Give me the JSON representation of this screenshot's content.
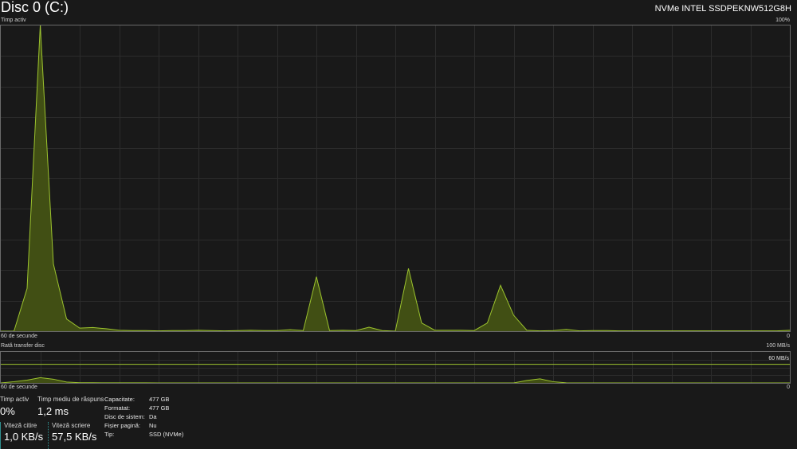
{
  "header": {
    "title": "Disc 0 (C:)",
    "model": "NVMe INTEL SSDPEKNW512G8H"
  },
  "active_chart": {
    "label": "Timp activ",
    "max_label": "100%",
    "time_label": "60 de secunde",
    "min_label": "0"
  },
  "transfer_chart": {
    "label": "Rată transfer disc",
    "max_label": "100 MB/s",
    "line_label": "60 MB/s",
    "time_label": "60 de secunde",
    "min_label": "0"
  },
  "stats": {
    "active_time": {
      "label": "Timp activ",
      "value": "0%"
    },
    "avg_response": {
      "label": "Timp mediu de răspuns",
      "value": "1,2 ms"
    },
    "read_speed": {
      "label": "Viteză citire",
      "value": "1,0 KB/s"
    },
    "write_speed": {
      "label": "Viteză scriere",
      "value": "57,5 KB/s"
    }
  },
  "properties": [
    {
      "label": "Capacitate:",
      "value": "477 GB"
    },
    {
      "label": "Formatat:",
      "value": "477 GB"
    },
    {
      "label": "Disc de sistem:",
      "value": "Da"
    },
    {
      "label": "Fișier pagină:",
      "value": "Nu"
    },
    {
      "label": "Tip:",
      "value": "SSD (NVMe)"
    }
  ],
  "colors": {
    "background": "#191919",
    "grid": "#2c2c2c",
    "border": "#6a6a6a",
    "fill": "#414f14",
    "line": "#9cc32e",
    "accent_teal": "#2f8f8f"
  },
  "chart_data": [
    {
      "type": "area",
      "title": "Timp activ",
      "xlabel": "60 de secunde",
      "ylabel": "",
      "ylim": [
        0,
        100
      ],
      "x": [
        0,
        1,
        2,
        3,
        4,
        5,
        6,
        7,
        8,
        9,
        10,
        11,
        12,
        13,
        14,
        15,
        16,
        17,
        18,
        19,
        20,
        21,
        22,
        23,
        24,
        25,
        26,
        27,
        28,
        29,
        30,
        31,
        32,
        33,
        34,
        35,
        36,
        37,
        38,
        39,
        40,
        41,
        42,
        43,
        44,
        45,
        46,
        47,
        48,
        49,
        50,
        51,
        52,
        53,
        54,
        55,
        56,
        57,
        58,
        59,
        60
      ],
      "series": [
        {
          "values": [
            0,
            0,
            14,
            100,
            22,
            4,
            1,
            1.2,
            0.8,
            0.3,
            0.2,
            0.2,
            0.1,
            0.2,
            0.2,
            0.3,
            0.2,
            0.1,
            0.2,
            0.3,
            0.2,
            0.2,
            0.5,
            0.2,
            17.8,
            0.2,
            0.3,
            0.2,
            1.3,
            0.2,
            0,
            20.5,
            2.7,
            0.3,
            0.3,
            0.3,
            0.2,
            2.7,
            15,
            5.2,
            0.3,
            0.1,
            0.2,
            0.6,
            0.1,
            0.2,
            0.2,
            0.1,
            0.1,
            0.1,
            0.1,
            0.1,
            0.1,
            0.1,
            0.1,
            0.1,
            0.1,
            0.1,
            0.1,
            0.1,
            0.3
          ]
        }
      ]
    },
    {
      "type": "area",
      "title": "Rată transfer disc",
      "xlabel": "60 de secunde",
      "ylabel": "",
      "ylim": [
        0,
        100
      ],
      "x": [
        0,
        1,
        2,
        3,
        4,
        5,
        6,
        7,
        8,
        9,
        10,
        11,
        12,
        13,
        14,
        15,
        16,
        17,
        18,
        19,
        20,
        21,
        22,
        23,
        24,
        25,
        26,
        27,
        28,
        29,
        30,
        31,
        32,
        33,
        34,
        35,
        36,
        37,
        38,
        39,
        40,
        41,
        42,
        43,
        44,
        45,
        46,
        47,
        48,
        49,
        50,
        51,
        52,
        53,
        54,
        55,
        56,
        57,
        58,
        59,
        60
      ],
      "series": [
        {
          "values": [
            0,
            4,
            9,
            17,
            12,
            3,
            0.5,
            0.5,
            0.3,
            0.2,
            0.2,
            0.2,
            0.1,
            0.1,
            0.1,
            0.1,
            0.1,
            0.1,
            0.1,
            0.1,
            0.1,
            0.1,
            0.1,
            0.1,
            0,
            0,
            0.1,
            0.1,
            0.1,
            0.1,
            0,
            0,
            0.1,
            0.1,
            0.1,
            0.1,
            0.1,
            0.1,
            0.1,
            0,
            8,
            13,
            4,
            0.3,
            0.1,
            0.1,
            0.1,
            0.1,
            0.1,
            0.1,
            0.1,
            0.1,
            0.1,
            0.1,
            0.1,
            0.1,
            0.1,
            0.1,
            0.1,
            0.1,
            0.1
          ]
        }
      ]
    }
  ]
}
